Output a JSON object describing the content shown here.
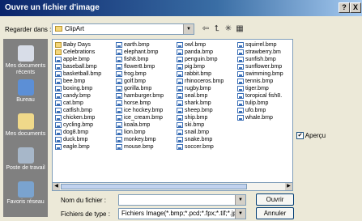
{
  "window": {
    "title": "Ouvre un fichier d'image",
    "help_button": "?",
    "close_button": "X"
  },
  "lookin": {
    "label": "Regarder dans :",
    "value": "ClipArt"
  },
  "places": [
    {
      "label": "Mes documents récents",
      "icon": "recent-documents-icon"
    },
    {
      "label": "Bureau",
      "icon": "desktop-icon"
    },
    {
      "label": "Mes documents",
      "icon": "my-documents-icon"
    },
    {
      "label": "Poste de travail",
      "icon": "my-computer-icon"
    },
    {
      "label": "Favoris réseau",
      "icon": "network-places-icon"
    }
  ],
  "files": {
    "col1": [
      {
        "name": "Baby Days",
        "type": "folder"
      },
      {
        "name": "Celebrations",
        "type": "folder"
      },
      {
        "name": "apple.bmp",
        "type": "bmp"
      },
      {
        "name": "baseball.bmp",
        "type": "bmp"
      },
      {
        "name": "basketball.bmp",
        "type": "bmp"
      },
      {
        "name": "bee.bmp",
        "type": "bmp"
      },
      {
        "name": "boxing.bmp",
        "type": "bmp"
      },
      {
        "name": "candy.bmp",
        "type": "bmp"
      },
      {
        "name": "cat.bmp",
        "type": "bmp"
      },
      {
        "name": "catfish.bmp",
        "type": "bmp"
      },
      {
        "name": "chicken.bmp",
        "type": "bmp"
      },
      {
        "name": "cycling.bmp",
        "type": "bmp"
      },
      {
        "name": "dog8.bmp",
        "type": "bmp"
      },
      {
        "name": "duck.bmp",
        "type": "bmp"
      },
      {
        "name": "eagle.bmp",
        "type": "bmp"
      }
    ],
    "col2": [
      {
        "name": "earth.bmp",
        "type": "bmp"
      },
      {
        "name": "elephant.bmp",
        "type": "bmp"
      },
      {
        "name": "fish8.bmp",
        "type": "bmp"
      },
      {
        "name": "flower8.bmp",
        "type": "bmp"
      },
      {
        "name": "frog.bmp",
        "type": "bmp"
      },
      {
        "name": "golf.bmp",
        "type": "bmp"
      },
      {
        "name": "gorilla.bmp",
        "type": "bmp"
      },
      {
        "name": "hamburger.bmp",
        "type": "bmp"
      },
      {
        "name": "horse.bmp",
        "type": "bmp"
      },
      {
        "name": "ice hockey.bmp",
        "type": "bmp"
      },
      {
        "name": "ice_cream.bmp",
        "type": "bmp"
      },
      {
        "name": "koala.bmp",
        "type": "bmp"
      },
      {
        "name": "lion.bmp",
        "type": "bmp"
      },
      {
        "name": "monkey.bmp",
        "type": "bmp"
      },
      {
        "name": "mouse.bmp",
        "type": "bmp"
      }
    ],
    "col3": [
      {
        "name": "owl.bmp",
        "type": "bmp"
      },
      {
        "name": "panda.bmp",
        "type": "bmp"
      },
      {
        "name": "penguin.bmp",
        "type": "bmp"
      },
      {
        "name": "pig.bmp",
        "type": "bmp"
      },
      {
        "name": "rabbit.bmp",
        "type": "bmp"
      },
      {
        "name": "rhinoceros.bmp",
        "type": "bmp"
      },
      {
        "name": "rugby.bmp",
        "type": "bmp"
      },
      {
        "name": "seal.bmp",
        "type": "bmp"
      },
      {
        "name": "shark.bmp",
        "type": "bmp"
      },
      {
        "name": "sheep.bmp",
        "type": "bmp"
      },
      {
        "name": "ship.bmp",
        "type": "bmp"
      },
      {
        "name": "ski.bmp",
        "type": "bmp"
      },
      {
        "name": "snail.bmp",
        "type": "bmp"
      },
      {
        "name": "snake.bmp",
        "type": "bmp"
      },
      {
        "name": "soccer.bmp",
        "type": "bmp"
      }
    ],
    "col4": [
      {
        "name": "squirrel.bmp",
        "type": "bmp"
      },
      {
        "name": "strawberry.bm",
        "type": "bmp"
      },
      {
        "name": "sunfish.bmp",
        "type": "bmp"
      },
      {
        "name": "sunflower.bmp",
        "type": "bmp"
      },
      {
        "name": "swimming.bmp",
        "type": "bmp"
      },
      {
        "name": "tennis.bmp",
        "type": "bmp"
      },
      {
        "name": "tiger.bmp",
        "type": "bmp"
      },
      {
        "name": "toropical fish8.",
        "type": "bmp"
      },
      {
        "name": "tulip.bmp",
        "type": "bmp"
      },
      {
        "name": "ufo.bmp",
        "type": "bmp"
      },
      {
        "name": "whale.bmp",
        "type": "bmp"
      }
    ]
  },
  "preview": {
    "label": "Aperçu",
    "checked": true
  },
  "filename": {
    "label": "Nom du fichier :",
    "value": ""
  },
  "filetype": {
    "label": "Fichiers de type :",
    "value": "Fichiers Image(*.bmp;*.pcd;*.fpx;*.tif;*.jpg;*.pcx;"
  },
  "buttons": {
    "open": "Ouvrir",
    "cancel": "Annuler"
  },
  "colors": {
    "titlebar": "#0a246a",
    "dialog": "#ece9d8",
    "places_bar": "#808080"
  }
}
